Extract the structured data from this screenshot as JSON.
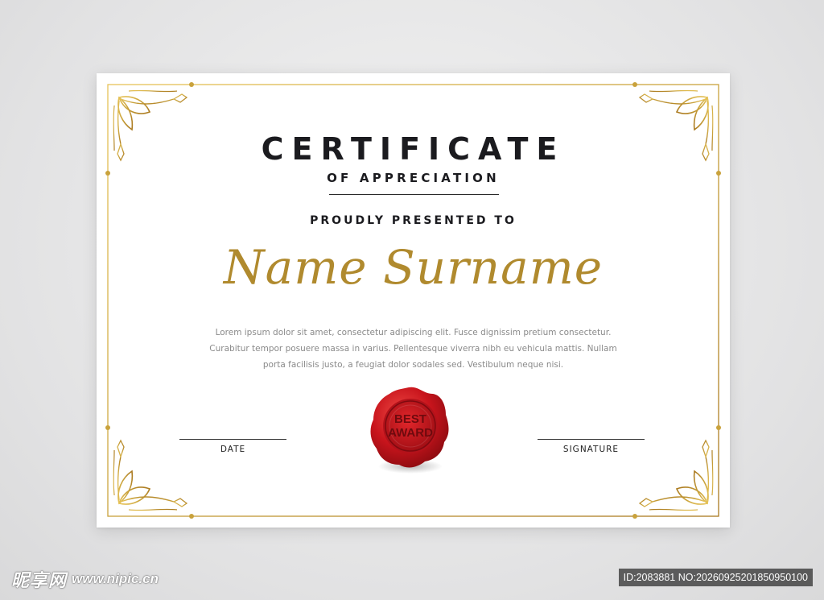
{
  "certificate": {
    "title": "CERTIFICATE",
    "subtitle": "OF APPRECIATION",
    "presented": "PROUDLY PRESENTED TO",
    "name": "Name Surname",
    "body_lines": [
      "Lorem ipsum dolor sit amet, consectetur adipiscing elit. Fusce dignissim pretium consectetur.",
      "Curabitur tempor posuere massa in varius. Pellentesque viverra nibh eu vehicula mattis. Nullam",
      "porta facilisis justo, a feugiat dolor sodales sed. Vestibulum neque nisi."
    ],
    "date_label": "DATE",
    "signature_label": "SIGNATURE",
    "seal_text": "BEST AWARD"
  },
  "colors": {
    "gold": "#c9a23c",
    "seal_red": "#c8141c",
    "text_dark": "#1b1b1f"
  },
  "watermark": {
    "site_name": "昵享网",
    "site_url": "www.nipic.cn",
    "id_text": "ID:2083881 NO:20260925201850950100"
  }
}
